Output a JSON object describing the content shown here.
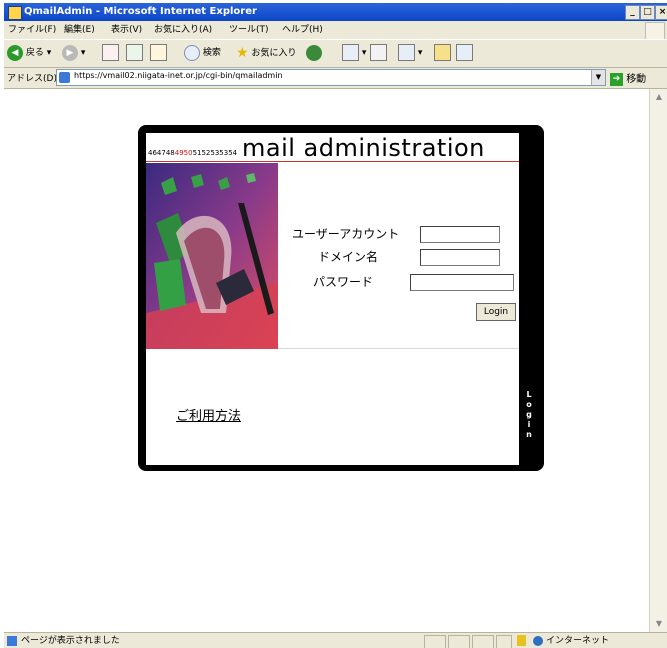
{
  "window": {
    "title": "QmailAdmin - Microsoft Internet Explorer",
    "controls": [
      "_",
      "□",
      "×"
    ]
  },
  "menu": [
    "ファイル(F)",
    "編集(E)",
    "表示(V)",
    "お気に入り(A)",
    "ツール(T)",
    "ヘルプ(H)"
  ],
  "toolbar": {
    "back_label": "戻る",
    "search_label": "検索",
    "favorites_label": "お気に入り"
  },
  "address": {
    "label": "アドレス(D)",
    "url": "https://vmail02.niigata-inet.or.jp/cgi-bin/qmailadmin",
    "go_label": "移動"
  },
  "page": {
    "header_nums": "464748",
    "header_nums_red": "4950",
    "header_nums_tail": "5152535354",
    "title": "mail administration",
    "form": {
      "user_label": "ユーザーアカウント",
      "domain_label": "ドメイン名",
      "password_label": "パスワード",
      "user_value": "",
      "domain_value": "",
      "password_value": "",
      "submit_label": "Login"
    },
    "help_link": "ご利用方法",
    "side_tab": "Login"
  },
  "status": {
    "text": "ページが表示されました",
    "zone": "インターネット"
  },
  "colors": {
    "title_bar": "#0b46c8",
    "panel_border": "#000000",
    "header_rule": "#c0392b"
  }
}
